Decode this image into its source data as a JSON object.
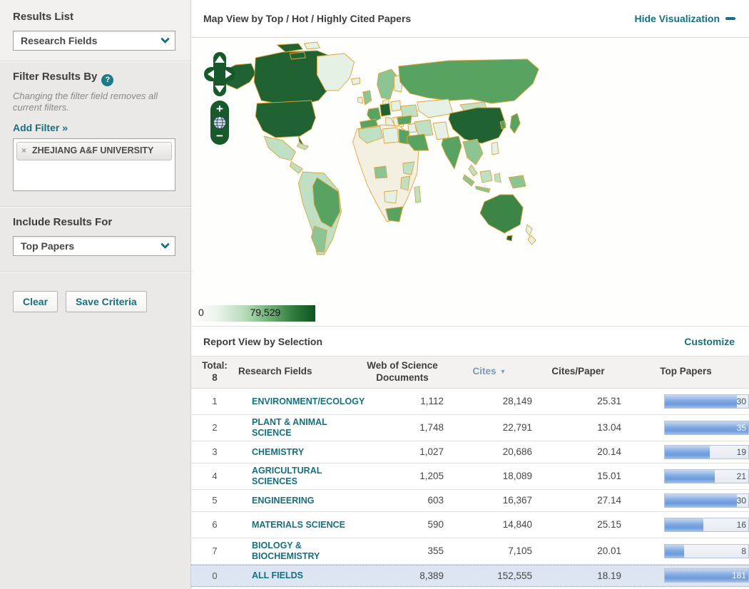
{
  "theme": {
    "teal": "#15707f",
    "map_border_orange": "#dfa53b",
    "map_green_dark": "#206231",
    "map_green_medium": "#58a361",
    "map_green_light": "#bfe0c3",
    "bar_blue": "#7ea7e2",
    "highlight_row_blue": "#dde5f2"
  },
  "sidebar": {
    "results_list": {
      "heading": "Results List",
      "dropdown_value": "Research Fields"
    },
    "filter": {
      "heading": "Filter Results By",
      "help_icon": "?",
      "note": "Changing the filter field removes all current filters.",
      "add_filter_label": "Add Filter »",
      "chip": {
        "remove_icon": "×",
        "label": "ZHEJIANG A&F UNIVERSITY"
      }
    },
    "include": {
      "heading": "Include Results For",
      "dropdown_value": "Top Papers"
    },
    "actions": {
      "clear_label": "Clear",
      "save_label": "Save Criteria"
    }
  },
  "map": {
    "title": "Map View by Top / Hot / Highly Cited Papers",
    "hide_label": "Hide Visualization",
    "legend": {
      "min": "0",
      "max": "79,529"
    },
    "controls": {
      "zoom_in": "+",
      "zoom_out": "−"
    }
  },
  "report": {
    "title": "Report View by Selection",
    "customize_label": "Customize",
    "total_label": "Total:",
    "total_value": "8",
    "columns": [
      "Research Fields",
      "Web of Science Documents",
      "Cites",
      "Cites/Paper",
      "Top Papers"
    ],
    "sort_indicator": "▼",
    "sorted_column": "Cites",
    "rows": [
      {
        "rank": "1",
        "field": "ENVIRONMENT/ECOLOGY",
        "docs": "1,112",
        "cites": "28,149",
        "cites_per_paper": "25.31",
        "top_papers": "30",
        "fill_pct": 86,
        "highlight": false,
        "tall": true
      },
      {
        "rank": "2",
        "field": "PLANT & ANIMAL SCIENCE",
        "docs": "1,748",
        "cites": "22,791",
        "cites_per_paper": "13.04",
        "top_papers": "35",
        "fill_pct": 100,
        "highlight": false,
        "tall": true
      },
      {
        "rank": "3",
        "field": "CHEMISTRY",
        "docs": "1,027",
        "cites": "20,686",
        "cites_per_paper": "20.14",
        "top_papers": "19",
        "fill_pct": 54,
        "highlight": false,
        "tall": false
      },
      {
        "rank": "4",
        "field": "AGRICULTURAL SCIENCES",
        "docs": "1,205",
        "cites": "18,089",
        "cites_per_paper": "15.01",
        "top_papers": "21",
        "fill_pct": 60,
        "highlight": false,
        "tall": true
      },
      {
        "rank": "5",
        "field": "ENGINEERING",
        "docs": "603",
        "cites": "16,367",
        "cites_per_paper": "27.14",
        "top_papers": "30",
        "fill_pct": 86,
        "highlight": false,
        "tall": false
      },
      {
        "rank": "6",
        "field": "MATERIALS SCIENCE",
        "docs": "590",
        "cites": "14,840",
        "cites_per_paper": "25.15",
        "top_papers": "16",
        "fill_pct": 46,
        "highlight": false,
        "tall": true
      },
      {
        "rank": "7",
        "field": "BIOLOGY & BIOCHEMISTRY",
        "docs": "355",
        "cites": "7,105",
        "cites_per_paper": "20.01",
        "top_papers": "8",
        "fill_pct": 23,
        "highlight": false,
        "tall": true
      },
      {
        "rank": "0",
        "field": "ALL FIELDS",
        "docs": "8,389",
        "cites": "152,555",
        "cites_per_paper": "18.19",
        "top_papers": "181",
        "fill_pct": 100,
        "highlight": true,
        "tall": false
      }
    ]
  }
}
